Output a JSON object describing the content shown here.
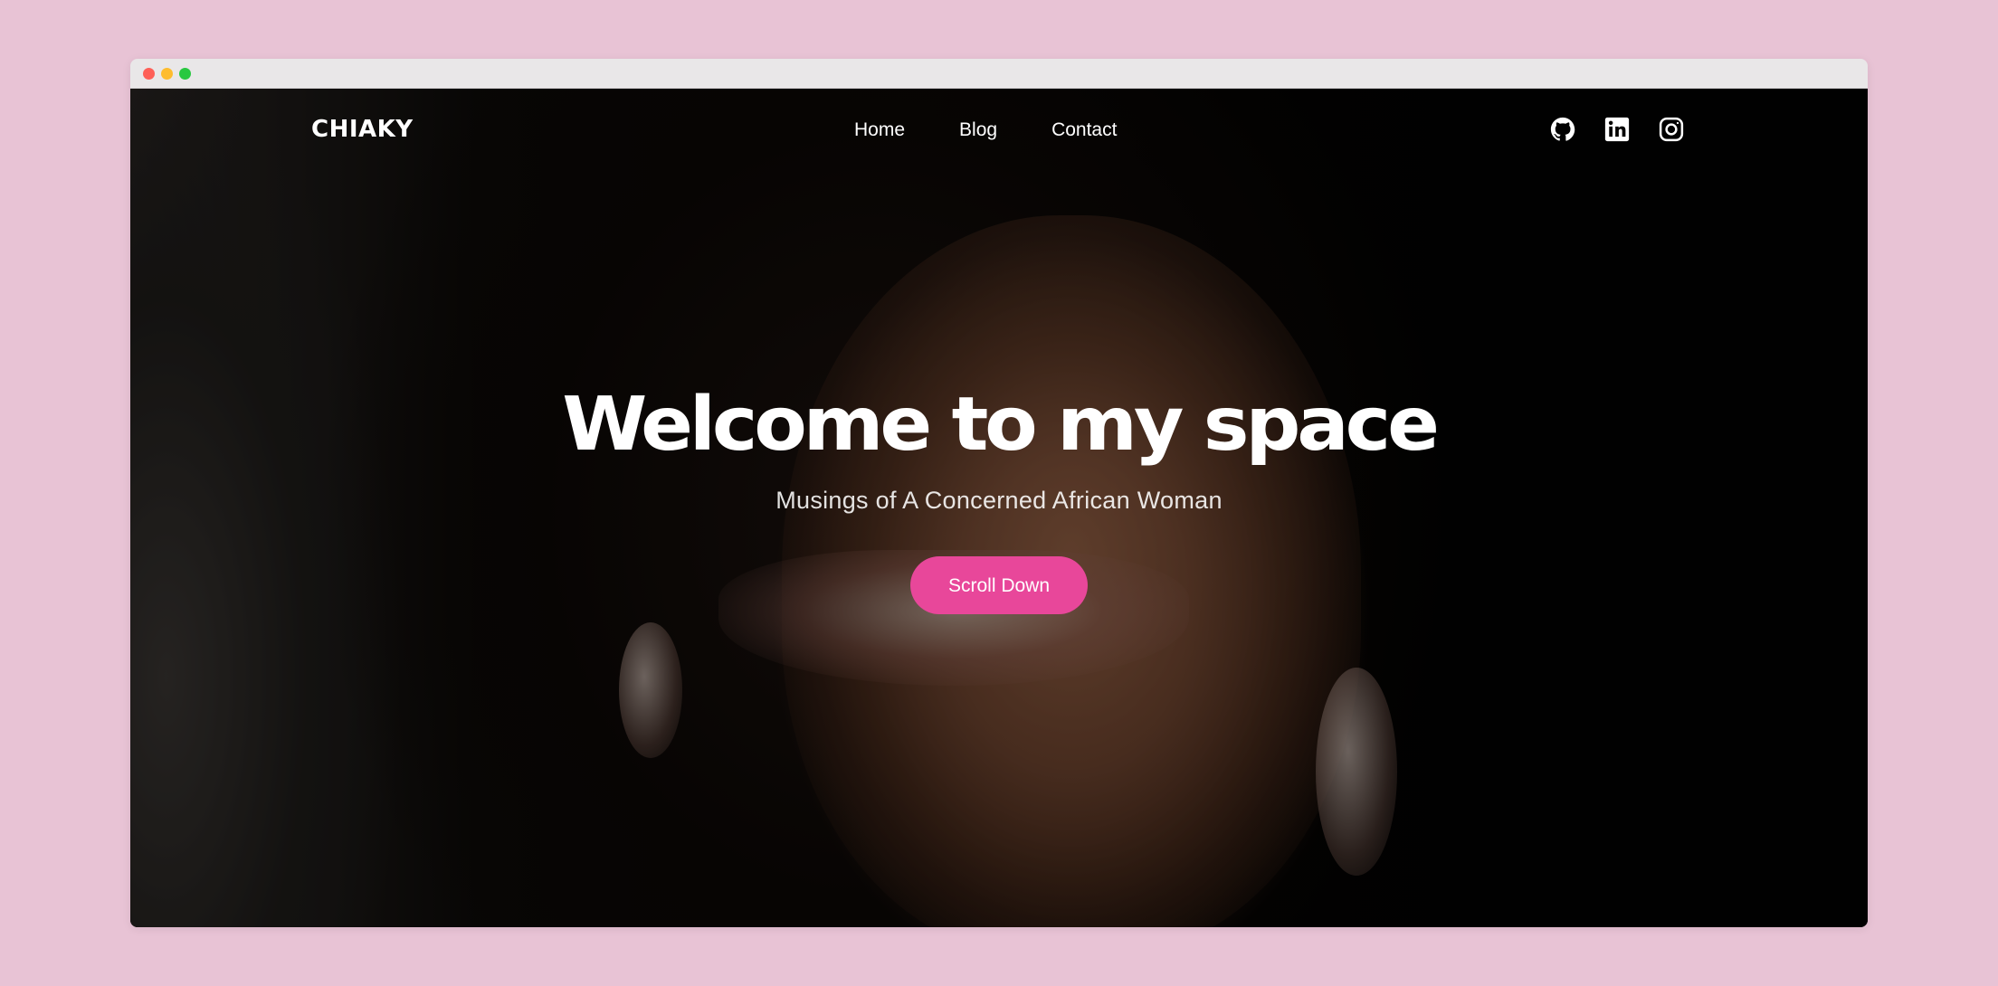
{
  "brand": {
    "logo": "CHIAKY",
    "accent_color": "#e8479a",
    "page_background": "#e8c3d5"
  },
  "nav": {
    "items": [
      {
        "label": "Home"
      },
      {
        "label": "Blog"
      },
      {
        "label": "Contact"
      }
    ],
    "socials": [
      {
        "icon": "github-icon"
      },
      {
        "icon": "linkedin-icon"
      },
      {
        "icon": "instagram-icon"
      }
    ]
  },
  "hero": {
    "title": "Welcome to my space",
    "subtitle": "Musings of A Concerned African Woman",
    "cta_label": "Scroll Down"
  }
}
